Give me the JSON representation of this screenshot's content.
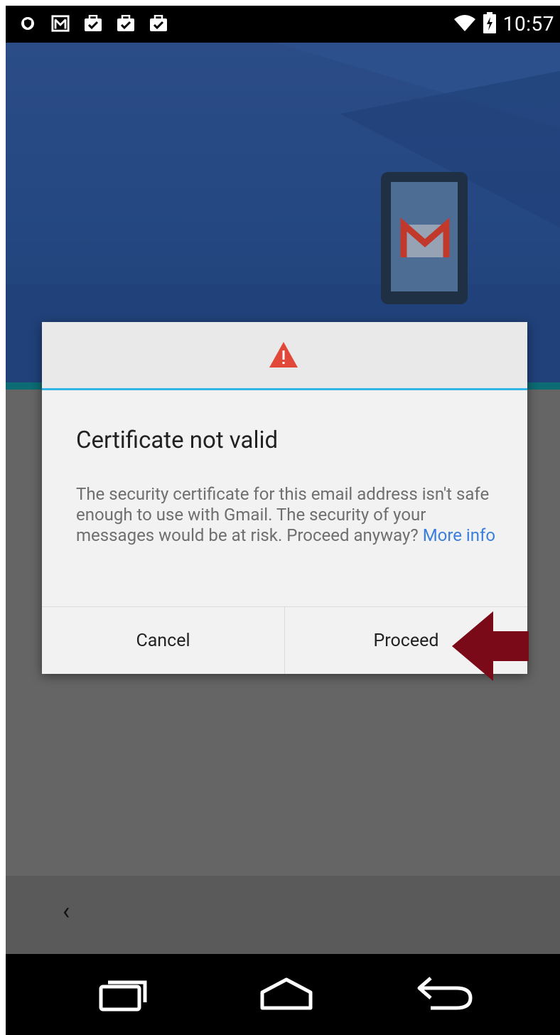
{
  "status_bar": {
    "time": "10:57",
    "left_icons": [
      "vpn-shield-icon",
      "gmail-notification-icon",
      "briefcase-check-icon",
      "briefcase-check-icon",
      "briefcase-check-icon"
    ],
    "right_icons": [
      "wifi-icon",
      "battery-charging-icon"
    ]
  },
  "dialog": {
    "title": "Certificate not valid",
    "body": "The security certificate for this email address isn't safe enough to use with Gmail. The security of your messages would be at risk. Proceed anyway? ",
    "more_info": "More info",
    "cancel_label": "Cancel",
    "proceed_label": "Proceed",
    "header_icon": "warning-triangle-icon"
  },
  "app_bar": {
    "back_glyph": "‹"
  },
  "colors": {
    "hero_blue": "#244781",
    "dialog_accent": "#33b5e5",
    "warning_red": "#e2483a",
    "annotation_arrow": "#7a0a18",
    "link_blue": "#3a7fdc"
  },
  "nav_bar": [
    "recent-apps-icon",
    "home-icon",
    "back-icon"
  ]
}
